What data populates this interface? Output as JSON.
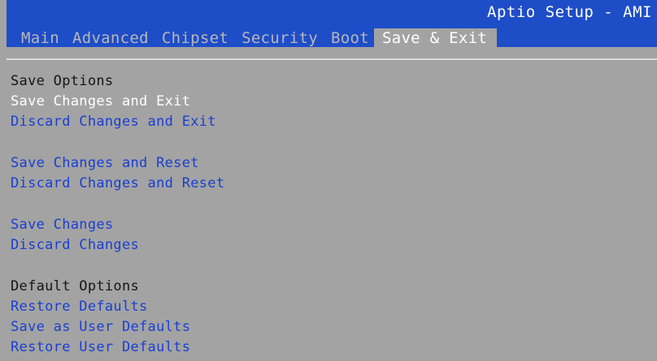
{
  "header": {
    "app_title": "Aptio Setup - AMI",
    "tabs": [
      "Main",
      "Advanced",
      "Chipset",
      "Security",
      "Boot",
      "Save & Exit"
    ],
    "selected_tab": "Save & Exit"
  },
  "menu": {
    "save_options_heading": "Save Options",
    "save_changes_and_exit": "Save Changes and Exit",
    "discard_changes_and_exit": "Discard Changes and Exit",
    "save_changes_and_reset": "Save Changes and Reset",
    "discard_changes_and_reset": "Discard Changes and Reset",
    "save_changes": "Save Changes",
    "discard_changes": "Discard Changes",
    "default_options_heading": "Default Options",
    "restore_defaults": "Restore Defaults",
    "save_as_user_defaults": "Save as User Defaults",
    "restore_user_defaults": "Restore User Defaults",
    "selected_item": "Save Changes and Exit"
  },
  "colors": {
    "header_bg": "#1e4dc8",
    "body_bg": "#a3a3a3",
    "item_text": "#1a3fd0",
    "heading_text": "#161616",
    "selected_text": "#ffffff",
    "tab_text": "#b8b8b8"
  }
}
